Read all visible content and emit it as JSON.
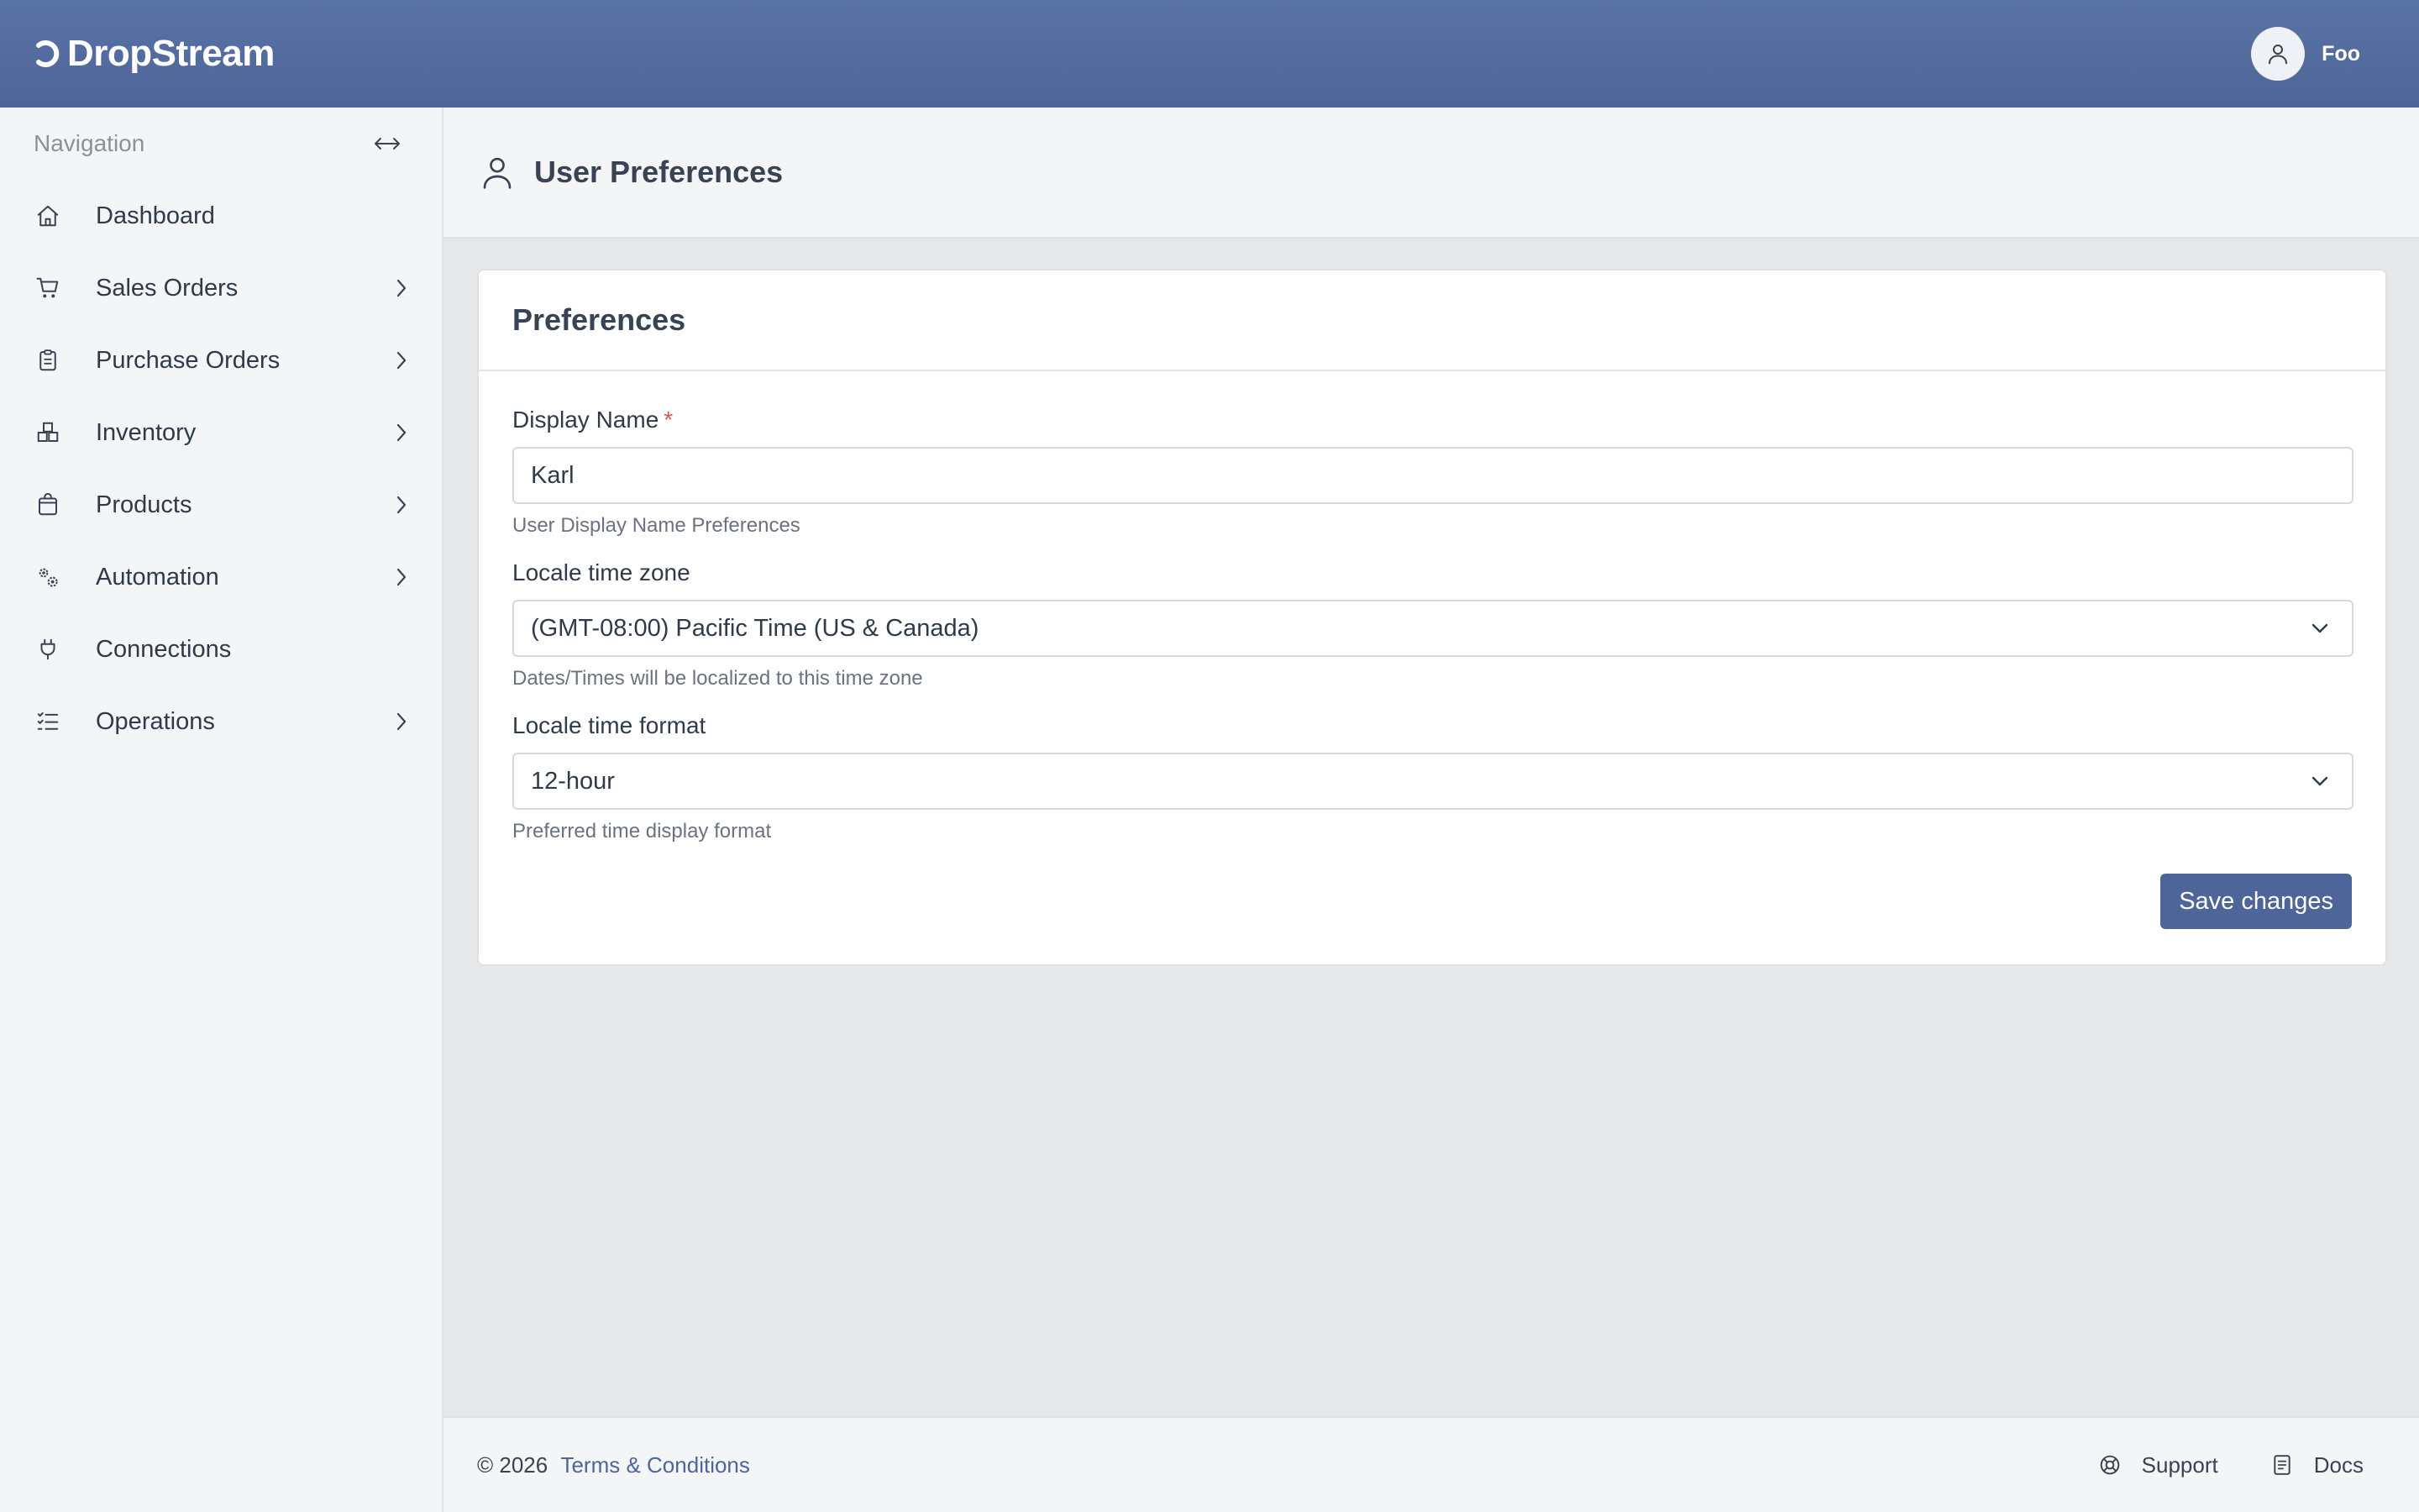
{
  "app": {
    "brand": "DropStream",
    "user_name": "Foo",
    "accent_color": "#4d6599"
  },
  "sidebar": {
    "title": "Navigation",
    "items": [
      {
        "label": "Dashboard",
        "icon": "home-icon",
        "has_children": false
      },
      {
        "label": "Sales Orders",
        "icon": "cart-icon",
        "has_children": true
      },
      {
        "label": "Purchase Orders",
        "icon": "clipboard-icon",
        "has_children": true
      },
      {
        "label": "Inventory",
        "icon": "boxes-icon",
        "has_children": true
      },
      {
        "label": "Products",
        "icon": "bag-icon",
        "has_children": true
      },
      {
        "label": "Automation",
        "icon": "gears-icon",
        "has_children": true
      },
      {
        "label": "Connections",
        "icon": "plug-icon",
        "has_children": false
      },
      {
        "label": "Operations",
        "icon": "list-icon",
        "has_children": true
      }
    ]
  },
  "page": {
    "title": "User Preferences"
  },
  "card": {
    "title": "Preferences",
    "display_name": {
      "label": "Display Name",
      "required_mark": "*",
      "value": "Karl",
      "hint": "User Display Name Preferences"
    },
    "time_zone": {
      "label": "Locale time zone",
      "value": "(GMT-08:00) Pacific Time (US & Canada)",
      "hint": "Dates/Times will be localized to this time zone"
    },
    "time_format": {
      "label": "Locale time format",
      "value": "12-hour",
      "hint": "Preferred time display format"
    },
    "save_label": "Save changes"
  },
  "footer": {
    "copyright": "© 2026",
    "terms_label": "Terms & Conditions",
    "support_label": "Support",
    "docs_label": "Docs"
  }
}
